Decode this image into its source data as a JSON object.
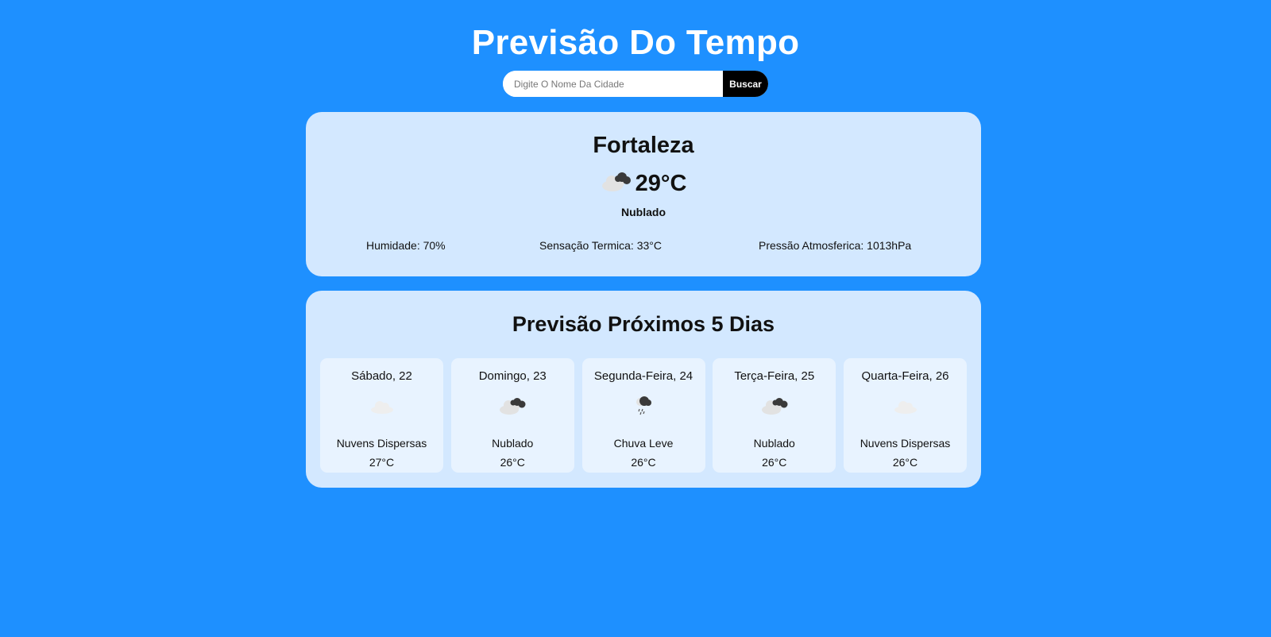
{
  "header": {
    "title": "Previsão Do Tempo"
  },
  "search": {
    "placeholder": "Digite O Nome Da Cidade",
    "value": "",
    "button_label": "Buscar"
  },
  "current": {
    "city": "Fortaleza",
    "icon": "cloud-dark-icon",
    "temperature": "29°C",
    "condition": "Nublado",
    "humidity": "Humidade: 70%",
    "feels_like": "Sensação Termica: 33°C",
    "pressure": "Pressão Atmosferica: 1013hPa"
  },
  "forecast": {
    "title": "Previsão Próximos 5 Dias",
    "days": [
      {
        "name": "Sábado, 22",
        "icon": "scattered-clouds-icon",
        "desc": "Nuvens Dispersas",
        "temp": "27°C"
      },
      {
        "name": "Domingo, 23",
        "icon": "cloud-dark-icon",
        "desc": "Nublado",
        "temp": "26°C"
      },
      {
        "name": "Segunda-Feira, 24",
        "icon": "light-rain-icon",
        "desc": "Chuva Leve",
        "temp": "26°C"
      },
      {
        "name": "Terça-Feira, 25",
        "icon": "cloud-dark-icon",
        "desc": "Nublado",
        "temp": "26°C"
      },
      {
        "name": "Quarta-Feira, 26",
        "icon": "scattered-clouds-icon",
        "desc": "Nuvens Dispersas",
        "temp": "26°C"
      }
    ]
  },
  "colors": {
    "background": "#1e90ff",
    "card": "#d3e8ff",
    "day_card": "#e8f3ff",
    "button": "#000000"
  }
}
